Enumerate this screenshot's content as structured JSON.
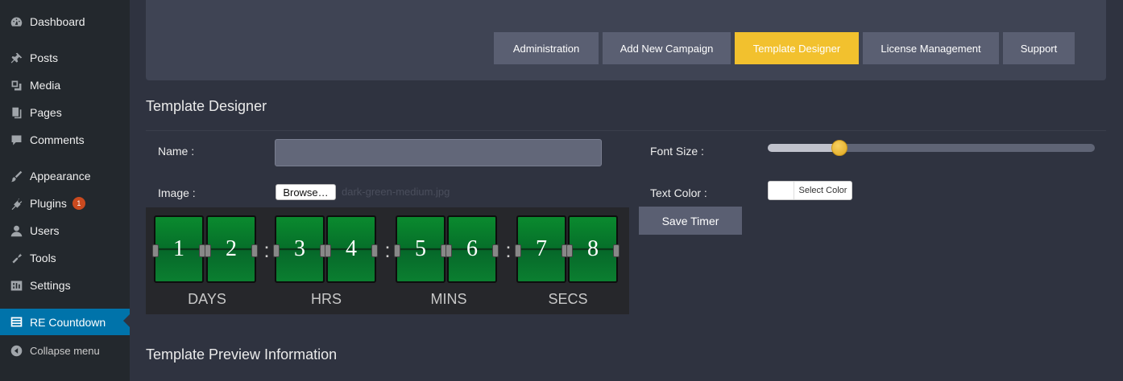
{
  "sidebar": {
    "items": [
      {
        "label": "Dashboard",
        "icon": "dashboard-icon"
      },
      {
        "label": "Posts",
        "icon": "pin-icon"
      },
      {
        "label": "Media",
        "icon": "media-icon"
      },
      {
        "label": "Pages",
        "icon": "pages-icon"
      },
      {
        "label": "Comments",
        "icon": "comment-icon"
      },
      {
        "label": "Appearance",
        "icon": "brush-icon"
      },
      {
        "label": "Plugins",
        "icon": "plug-icon",
        "badge": "1"
      },
      {
        "label": "Users",
        "icon": "user-icon"
      },
      {
        "label": "Tools",
        "icon": "wrench-icon"
      },
      {
        "label": "Settings",
        "icon": "settings-icon"
      },
      {
        "label": "RE Countdown",
        "icon": "list-icon"
      }
    ],
    "collapse_label": "Collapse menu"
  },
  "tabs": [
    {
      "label": "Administration"
    },
    {
      "label": "Add New Campaign"
    },
    {
      "label": "Template Designer"
    },
    {
      "label": "License Management"
    },
    {
      "label": "Support"
    }
  ],
  "active_tab": "Template Designer",
  "page_title": "Template Designer",
  "form": {
    "name_label": "Name :",
    "name_value": "",
    "image_label": "Image :",
    "browse_label": "Browse…",
    "file_name": "dark-green-medium.jpg",
    "font_size_label": "Font Size :",
    "font_size_level": 0.22,
    "text_color_label": "Text Color :",
    "select_color_label": "Select Color",
    "save_label": "Save Timer"
  },
  "countdown": {
    "digits": [
      "1",
      "2",
      "3",
      "4",
      "5",
      "6",
      "7",
      "8"
    ],
    "separator": ":",
    "units": [
      "DAYS",
      "HRS",
      "MINS",
      "SECS"
    ]
  },
  "preview_title": "Template Preview Information",
  "colors": {
    "accent": "#f2c12e",
    "sidebar_active": "#0073aa",
    "badge": "#ca4a1f"
  }
}
